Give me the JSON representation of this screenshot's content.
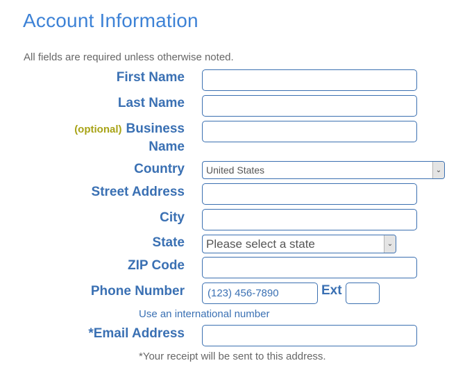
{
  "header": {
    "title": "Account Information",
    "note": "All fields are required unless otherwise noted."
  },
  "fields": {
    "first_name": {
      "label": "First Name",
      "value": ""
    },
    "last_name": {
      "label": "Last Name",
      "value": ""
    },
    "business_name": {
      "optional_tag": "(optional)",
      "label_line1": "Business",
      "label_line2": "Name",
      "value": ""
    },
    "country": {
      "label": "Country",
      "selected": "United States"
    },
    "street_address": {
      "label": "Street Address",
      "value": ""
    },
    "city": {
      "label": "City",
      "value": ""
    },
    "state": {
      "label": "State",
      "selected": "Please select a state"
    },
    "zip": {
      "label": "ZIP Code",
      "value": ""
    },
    "phone": {
      "label": "Phone Number",
      "placeholder": "(123) 456-7890",
      "ext_label": "Ext",
      "ext_value": ""
    },
    "international_link": "Use an international number",
    "email": {
      "label": "*Email Address",
      "value": "",
      "hint": "*Your receipt will be sent to this address."
    }
  },
  "colors": {
    "title": "#3d82d6",
    "label": "#3a70b3",
    "optional": "#a8a316",
    "border": "#3a6fb0"
  }
}
